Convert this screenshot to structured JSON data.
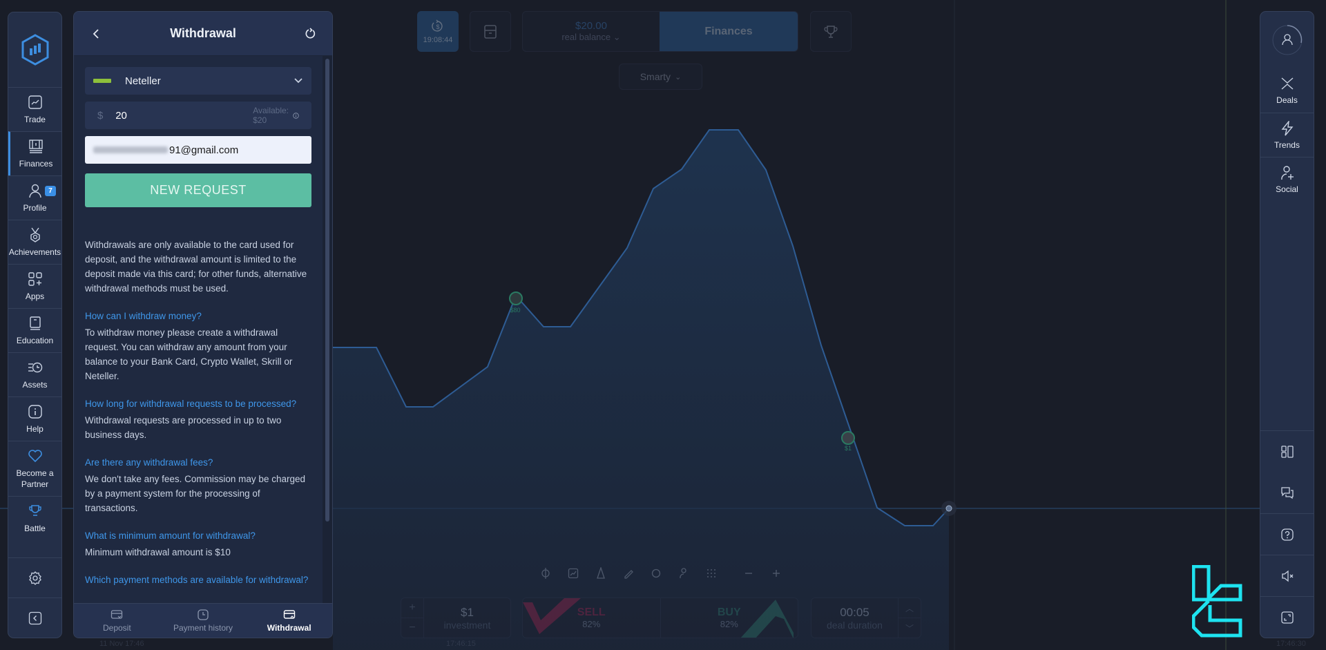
{
  "left_sidebar": {
    "items": [
      {
        "label": "Trade",
        "icon": "chart-icon"
      },
      {
        "label": "Finances",
        "icon": "finances-icon",
        "active": true
      },
      {
        "label": "Profile",
        "icon": "user-icon",
        "badge": "7"
      },
      {
        "label": "Achievements",
        "icon": "medal-icon"
      },
      {
        "label": "Apps",
        "icon": "apps-icon"
      },
      {
        "label": "Education",
        "icon": "book-icon"
      },
      {
        "label": "Assets",
        "icon": "assets-clock-icon"
      },
      {
        "label": "Help",
        "icon": "info-icon"
      },
      {
        "label": "Become a Partner",
        "icon": "heart-icon"
      },
      {
        "label": "Battle",
        "icon": "trophy-icon"
      }
    ],
    "bottom": [
      {
        "icon": "gear-icon"
      },
      {
        "icon": "collapse-left-icon"
      }
    ]
  },
  "panel": {
    "title": "Withdrawal",
    "method": "Neteller",
    "currency_symbol": "$",
    "amount": "20",
    "available": "Available: $20",
    "email_visible_suffix": "91@gmail.com",
    "new_request_label": "NEW REQUEST",
    "intro": "Withdrawals are only available to the card used for deposit, and the withdrawal amount is limited to the deposit made via this card; for other funds, alternative withdrawal methods must be used.",
    "faq": [
      {
        "q": "How can I withdraw money?",
        "a": "To withdraw money please create a withdrawal request. You can withdraw any amount from your balance to your Bank Card, Crypto Wallet, Skrill or Neteller."
      },
      {
        "q": "How long for withdrawal requests to be processed?",
        "a": "Withdrawal requests are processed in up to two business days."
      },
      {
        "q": "Are there any withdrawal fees?",
        "a": "We don't take any fees. Commission may be charged by a payment system for the processing of transactions."
      },
      {
        "q": "What is minimum amount for withdrawal?",
        "a": "Minimum withdrawal amount is $10"
      },
      {
        "q": "Which payment methods are available for withdrawal?",
        "a": ""
      }
    ],
    "tabs": [
      {
        "label": "Deposit",
        "icon": "card-in-icon"
      },
      {
        "label": "Payment history",
        "icon": "clock-icon"
      },
      {
        "label": "Withdrawal",
        "icon": "card-out-icon",
        "active": true
      }
    ]
  },
  "topbar": {
    "timer": "19:08:44",
    "balance_amount": "$20.00",
    "balance_label": "real balance",
    "finances_label": "Finances",
    "strategy": "Smarty"
  },
  "trade": {
    "investment_value": "$1",
    "investment_label": "investment",
    "sell_label": "SELL",
    "sell_pct": "82%",
    "buy_label": "BUY",
    "buy_pct": "82%",
    "duration_value": "00:05",
    "duration_label": "deal duration",
    "time_labels": [
      "11 Nov 17:46",
      "17:46:15",
      "17:46:30"
    ]
  },
  "chart_markers": [
    {
      "label": "$80"
    },
    {
      "label": "$1"
    }
  ],
  "right_sidebar": {
    "items": [
      {
        "label": "Deals",
        "icon": "deals-icon"
      },
      {
        "label": "Trends",
        "icon": "lightning-icon"
      },
      {
        "label": "Social",
        "icon": "add-user-icon"
      }
    ],
    "bottom": [
      {
        "icon": "layout-icon"
      },
      {
        "icon": "chat-icon"
      },
      {
        "icon": "help-icon"
      },
      {
        "icon": "mute-icon"
      },
      {
        "icon": "fullscreen-icon"
      }
    ]
  },
  "colors": {
    "accent": "#3d8ee0",
    "buy": "#5cbea3",
    "sell": "#8e2248",
    "panel_bg": "#1f2940",
    "watermark": "#1ee3f0"
  }
}
